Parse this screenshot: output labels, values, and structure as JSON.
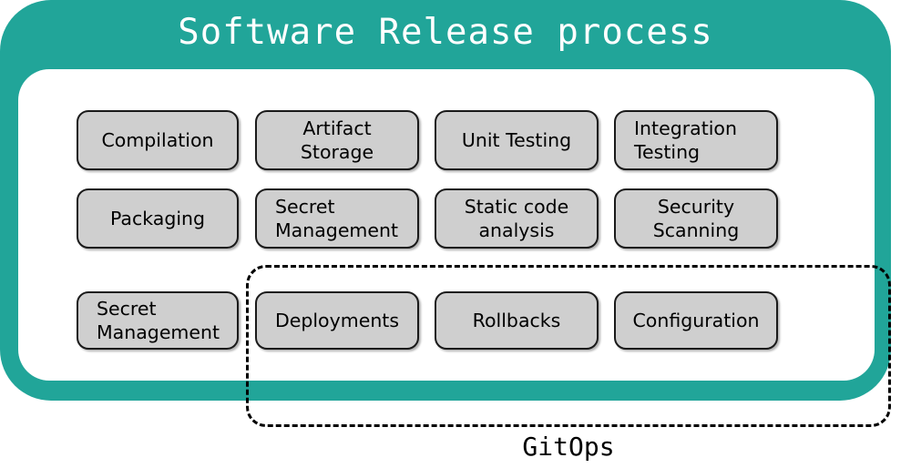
{
  "diagram": {
    "title": "Software Release process",
    "group_label": "GitOps",
    "colors": {
      "frame": "#21a599",
      "panel": "#ffffff",
      "box_fill": "#cfcfcf",
      "box_border": "#1a1a1a",
      "text": "#000000",
      "title_text": "#ffffff",
      "dashed_border": "#000000"
    },
    "items": [
      {
        "label": "Compilation",
        "align": "center",
        "row": 1,
        "col": 1
      },
      {
        "label": "Artifact\nStorage",
        "align": "center",
        "row": 1,
        "col": 2
      },
      {
        "label": "Unit Testing",
        "align": "center",
        "row": 1,
        "col": 3
      },
      {
        "label": "Integration\nTesting",
        "align": "left",
        "row": 1,
        "col": 4
      },
      {
        "label": "Packaging",
        "align": "center",
        "row": 2,
        "col": 1
      },
      {
        "label": "Secret\nManagement",
        "align": "left",
        "row": 2,
        "col": 2
      },
      {
        "label": "Static code\nanalysis",
        "align": "center",
        "row": 2,
        "col": 3
      },
      {
        "label": "Security\nScanning",
        "align": "center",
        "row": 2,
        "col": 4
      },
      {
        "label": "Secret\nManagement",
        "align": "left",
        "row": 3,
        "col": 1
      },
      {
        "label": "Deployments",
        "align": "center",
        "row": 3,
        "col": 2
      },
      {
        "label": "Rollbacks",
        "align": "center",
        "row": 3,
        "col": 3
      },
      {
        "label": "Configuration",
        "align": "center",
        "row": 3,
        "col": 4
      }
    ]
  }
}
